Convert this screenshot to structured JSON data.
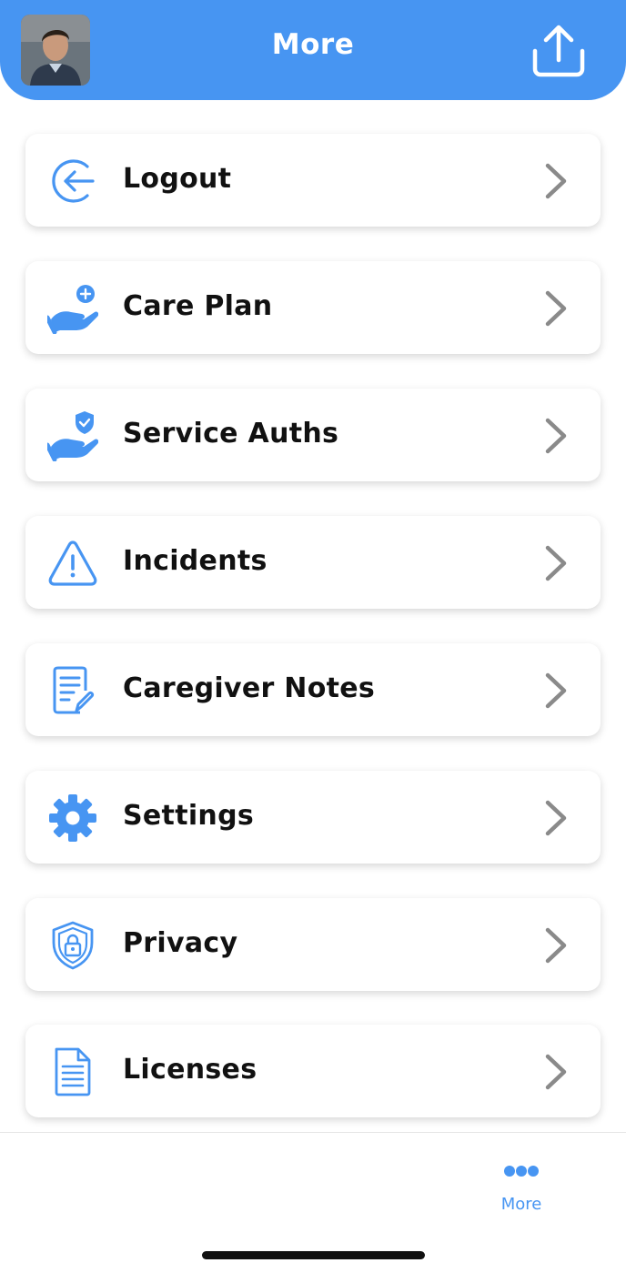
{
  "header": {
    "title": "More",
    "accent_color": "#4795f2",
    "avatar": "user-avatar-photo",
    "share_icon": "share-upload-icon"
  },
  "menu": [
    {
      "id": "logout",
      "label": "Logout",
      "icon": "logout-icon"
    },
    {
      "id": "care-plan",
      "label": "Care Plan",
      "icon": "care-plan-icon"
    },
    {
      "id": "service-auths",
      "label": "Service Auths",
      "icon": "service-auth-icon"
    },
    {
      "id": "incidents",
      "label": "Incidents",
      "icon": "warning-icon"
    },
    {
      "id": "caregiver-notes",
      "label": "Caregiver Notes",
      "icon": "notes-icon"
    },
    {
      "id": "settings",
      "label": "Settings",
      "icon": "gear-icon"
    },
    {
      "id": "privacy",
      "label": "Privacy",
      "icon": "privacy-shield-icon"
    },
    {
      "id": "licenses",
      "label": "Licenses",
      "icon": "document-icon"
    }
  ],
  "tabbar": {
    "active_tab": {
      "label": "More",
      "icon": "more-dots-icon"
    }
  }
}
